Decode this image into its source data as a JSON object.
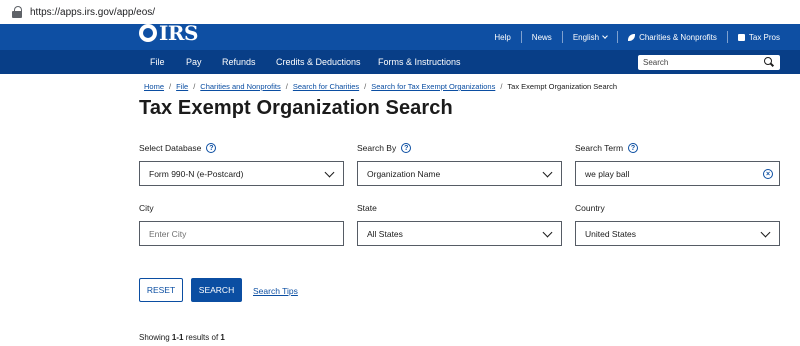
{
  "browser": {
    "url": "https://apps.irs.gov/app/eos/"
  },
  "header": {
    "logo_text": "IRS",
    "utility": {
      "help": "Help",
      "news": "News",
      "language": "English",
      "charities": "Charities & Nonprofits",
      "tax_pros": "Tax Pros"
    },
    "nav": [
      "File",
      "Pay",
      "Refunds",
      "Credits & Deductions",
      "Forms & Instructions"
    ],
    "search_placeholder": "Search"
  },
  "breadcrumb": {
    "items": [
      "Home",
      "File",
      "Charities and Nonprofits",
      "Search for Charities",
      "Search for Tax Exempt Organizations"
    ],
    "current": "Tax Exempt Organization Search"
  },
  "page_title": "Tax Exempt Organization Search",
  "form": {
    "select_database": {
      "label": "Select Database",
      "value": "Form 990-N (e-Postcard)"
    },
    "search_by": {
      "label": "Search By",
      "value": "Organization Name"
    },
    "search_term": {
      "label": "Search Term",
      "value": "we play ball"
    },
    "city": {
      "label": "City",
      "placeholder": "Enter City"
    },
    "state": {
      "label": "State",
      "value": "All States"
    },
    "country": {
      "label": "Country",
      "value": "United States"
    },
    "help_glyph": "?"
  },
  "actions": {
    "reset": "RESET",
    "search": "SEARCH",
    "tips": "Search Tips"
  },
  "results": {
    "prefix": "Showing ",
    "range": "1-1",
    "middle": " results of ",
    "total": "1"
  }
}
